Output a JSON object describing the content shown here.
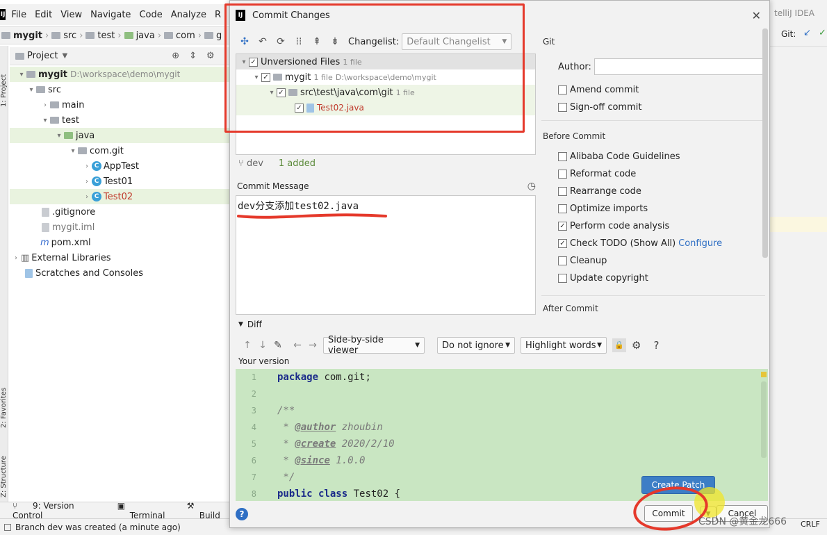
{
  "ide": {
    "menu": [
      "File",
      "Edit",
      "View",
      "Navigate",
      "Code",
      "Analyze",
      "R"
    ],
    "breadcrumbs": [
      "mygit",
      "src",
      "test",
      "java",
      "com",
      "g"
    ],
    "side_tabs": [
      "1: Project",
      "2: Favorites",
      "Z: Structure"
    ],
    "project_header": "Project",
    "tree": [
      {
        "label": "mygit",
        "extra": "D:\\workspace\\demo\\mygit"
      },
      {
        "label": "src"
      },
      {
        "label": "main"
      },
      {
        "label": "test"
      },
      {
        "label": "java"
      },
      {
        "label": "com.git"
      },
      {
        "label": "AppTest"
      },
      {
        "label": "Test01"
      },
      {
        "label": "Test02"
      },
      {
        "label": ".gitignore"
      },
      {
        "label": "mygit.iml"
      },
      {
        "label": "pom.xml"
      },
      {
        "label": "External Libraries"
      },
      {
        "label": "Scratches and Consoles"
      }
    ],
    "bottom_tabs": [
      "9: Version Control",
      "Terminal",
      "Build"
    ],
    "status": "Branch dev was created (a minute ago)",
    "right_title": "telliJ IDEA",
    "right_git": "Git:",
    "crlf": "CRLF"
  },
  "dialog": {
    "title": "Commit Changes",
    "changelist_label": "Changelist:",
    "changelist_value": "Default Changelist",
    "files": {
      "unversioned": "Unversioned Files",
      "unversioned_count": "1 file",
      "module": "mygit",
      "module_count": "1 file",
      "module_path": "D:\\workspace\\demo\\mygit",
      "dir": "src\\test\\java\\com\\git",
      "dir_count": "1 file",
      "file": "Test02.java"
    },
    "branch": "dev",
    "added": "1 added",
    "commit_message_label": "Commit Message",
    "commit_message": "dev分支添加test02.java",
    "git": {
      "section": "Git",
      "author_label": "Author:",
      "amend": "Amend commit",
      "signoff": "Sign-off commit"
    },
    "before_commit": {
      "section": "Before Commit",
      "options": [
        {
          "label": "Alibaba Code Guidelines",
          "checked": false
        },
        {
          "label": "Reformat code",
          "checked": false
        },
        {
          "label": "Rearrange code",
          "checked": false
        },
        {
          "label": "Optimize imports",
          "checked": false
        },
        {
          "label": "Perform code analysis",
          "checked": true
        },
        {
          "label": "Check TODO (Show All)",
          "checked": true
        },
        {
          "label": "Cleanup",
          "checked": false
        },
        {
          "label": "Update copyright",
          "checked": false
        }
      ],
      "configure": "Configure"
    },
    "after_commit": "After Commit",
    "diff": {
      "section": "Diff",
      "viewer": "Side-by-side viewer",
      "ignore": "Do not ignore",
      "highlight": "Highlight words",
      "your_version": "Your version",
      "lines": [
        {
          "n": "1",
          "t": "package com.git;"
        },
        {
          "n": "2",
          "t": ""
        },
        {
          "n": "3",
          "t": "/**"
        },
        {
          "n": "4",
          "t": " * @author zhoubin"
        },
        {
          "n": "5",
          "t": " * @create 2020/2/10"
        },
        {
          "n": "6",
          "t": " * @since 1.0.0"
        },
        {
          "n": "7",
          "t": " */"
        },
        {
          "n": "8",
          "t": "public class Test02 {"
        }
      ]
    },
    "buttons": {
      "create_patch": "Create Patch",
      "commit": "Commit",
      "cancel": "Cancel"
    }
  },
  "watermark": "CSDN @黄金龙666",
  "colors": {
    "annotation_red": "#e5392b",
    "accent_blue": "#2f6fc4",
    "diff_green": "#c9e6c2"
  }
}
